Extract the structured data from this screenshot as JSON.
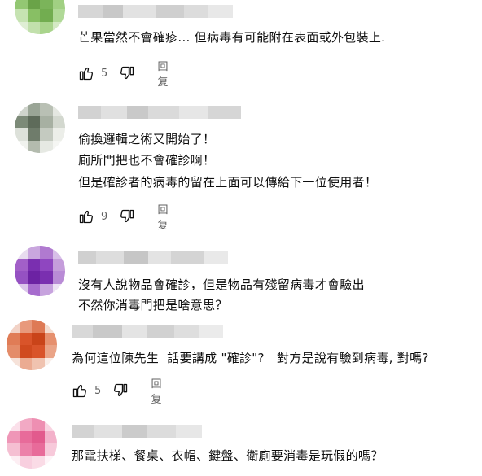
{
  "comments": [
    {
      "text": "芒果當然不會確疹... 但病毒有可能附在表面或外包裝上.",
      "likes": "5",
      "reply_label": "回复"
    },
    {
      "lines": [
        "偷換邏輯之術又開始了！",
        "廁所門把也不會確診啊！",
        "但是確診者的病毒的留在上面可以傳給下一位使用者！"
      ],
      "likes": "9",
      "reply_label": "回复"
    },
    {
      "lines": [
        "沒有人說物品會確診，但是物品有殘留病毒才會驗出",
        "不然你消毒門把是啥意思？"
      ]
    },
    {
      "text": "為何這位陳先生  話要講成 \"確診\"?   對方是說有驗到病毒, 對嗎?",
      "likes": "5",
      "reply_label": "回复"
    },
    {
      "text": "那電扶梯、餐桌、衣帽、鍵盤、衛廁要消毒是玩假的嗎？"
    }
  ],
  "icons": {
    "like": "thumb-up-icon",
    "dislike": "thumb-down-icon"
  },
  "colors": {
    "secondary_text": "#606060",
    "avatar_1": "#7bb45a",
    "avatar_2": "#7c8a78",
    "avatar_3": "#7a2fb0",
    "avatar_4": "#d9542a",
    "avatar_5": "#e86b9a"
  }
}
